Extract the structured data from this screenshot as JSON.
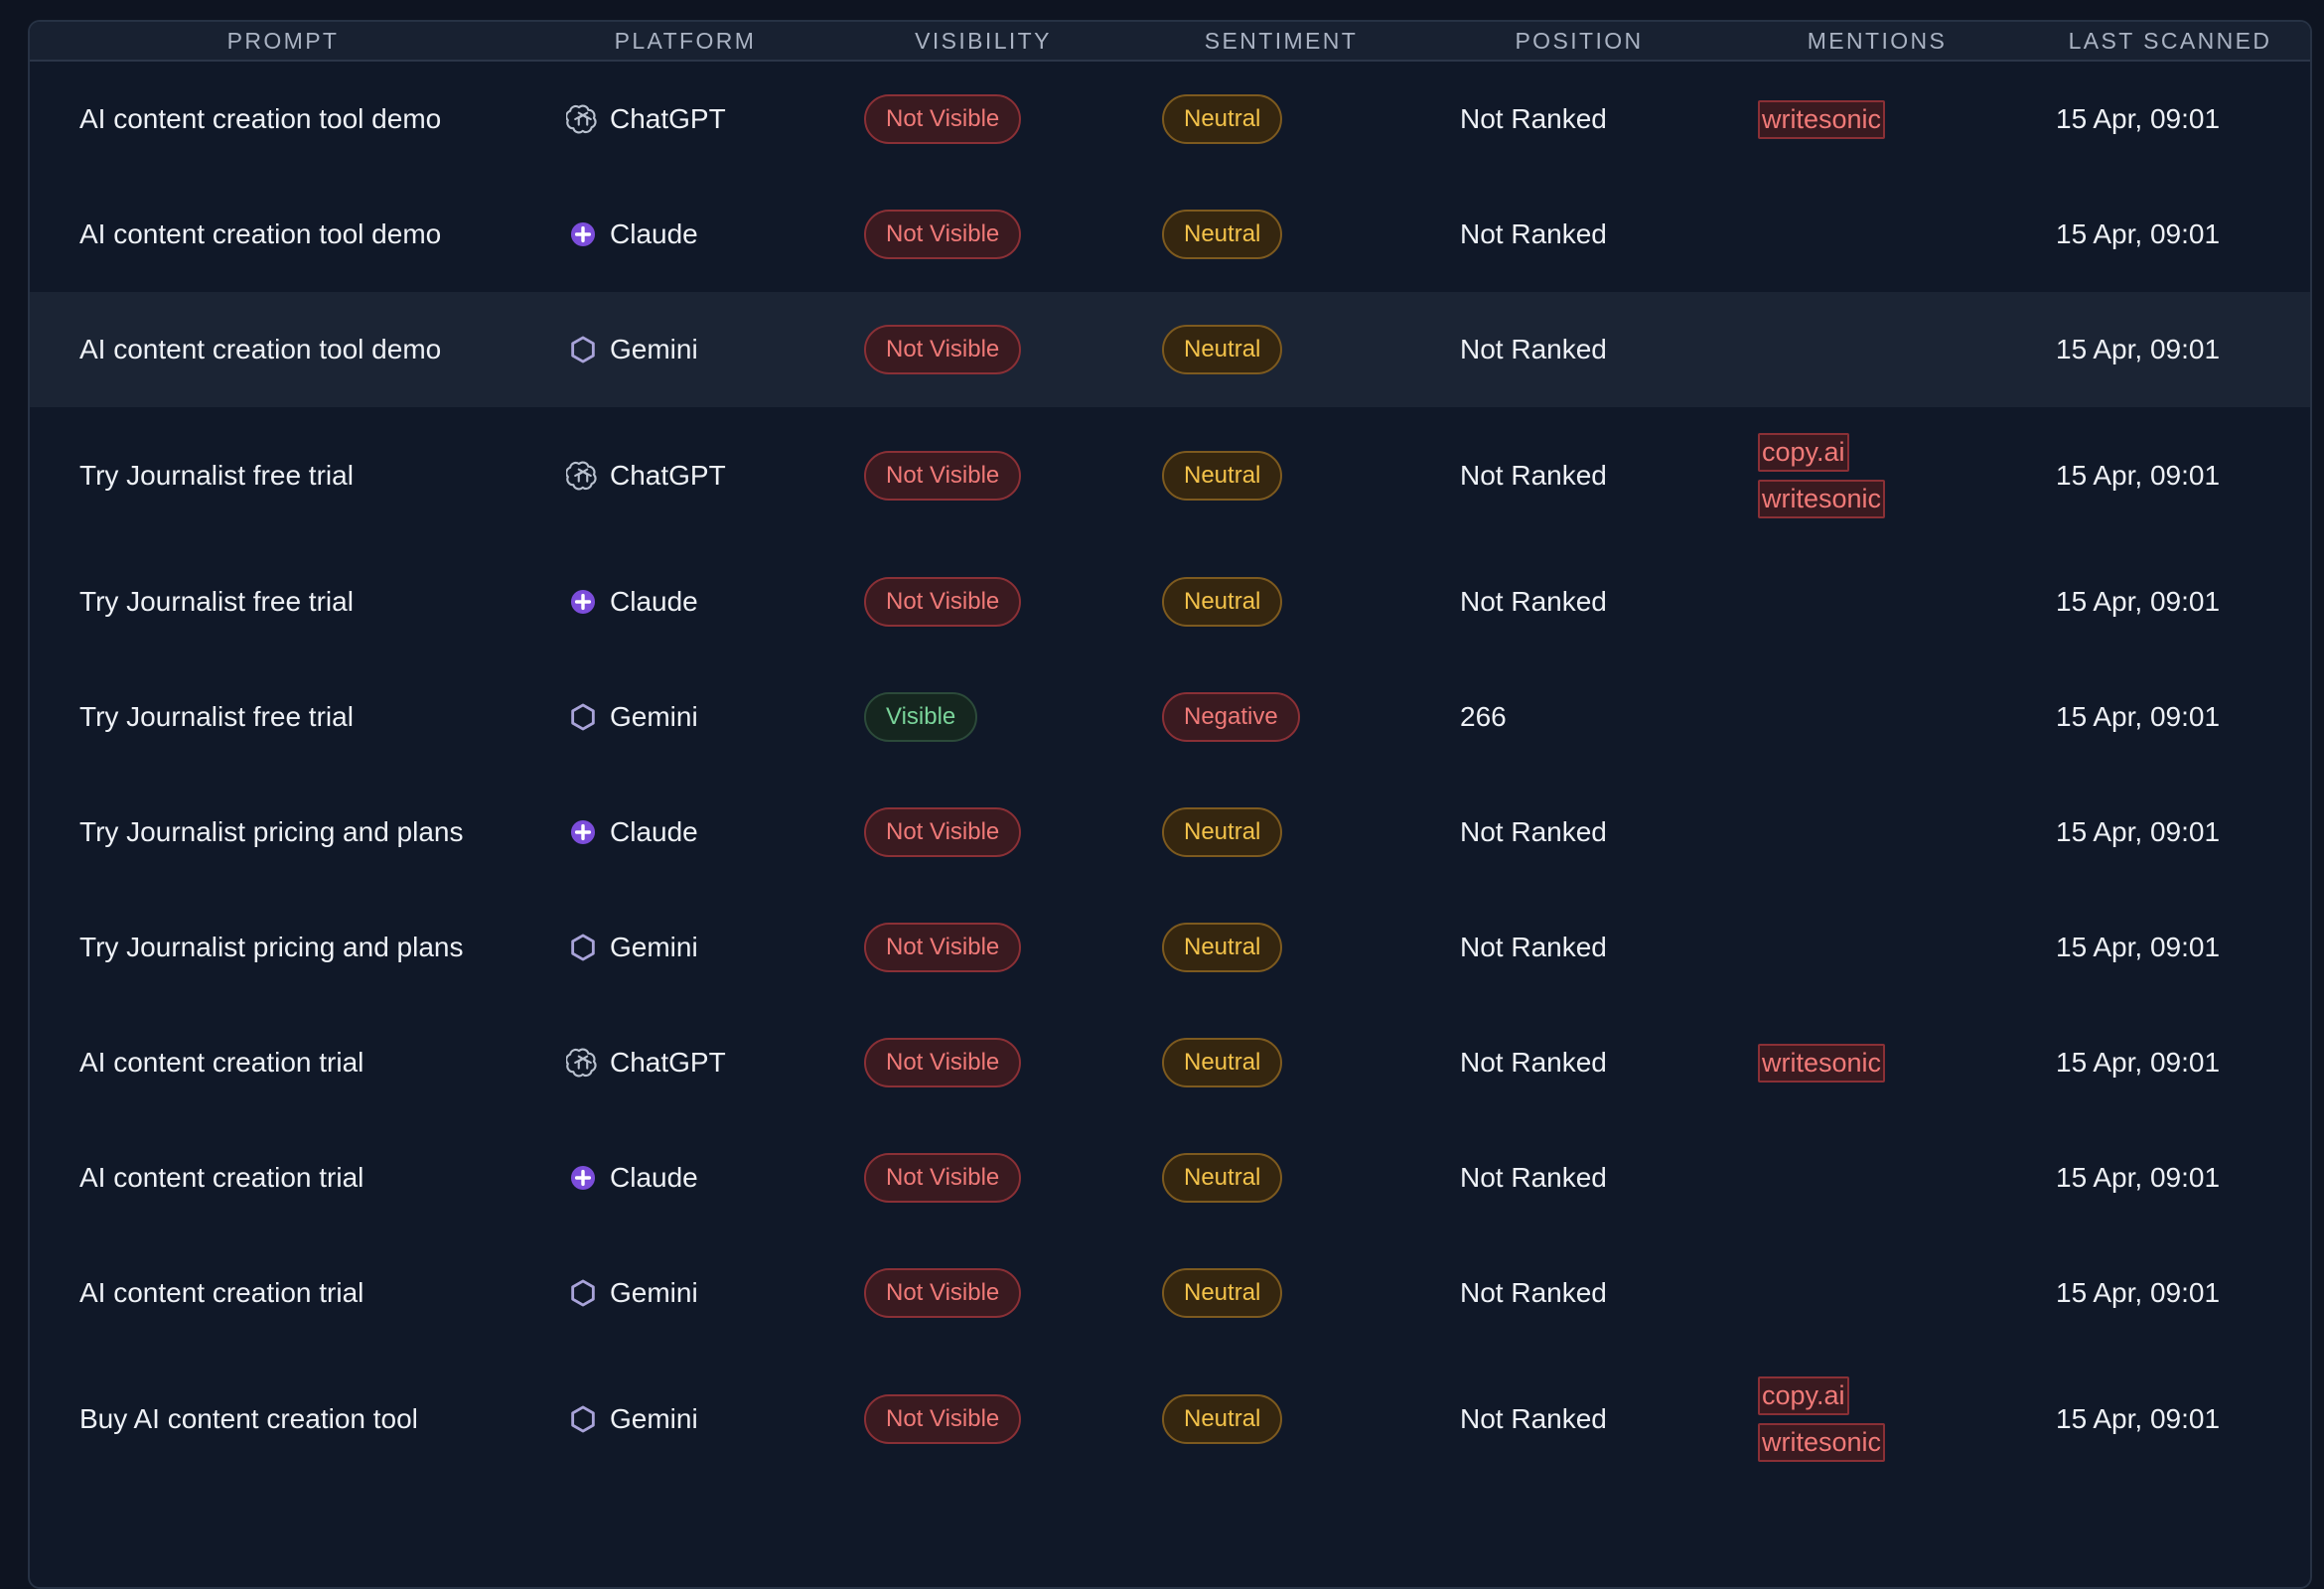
{
  "table": {
    "headers": [
      "Prompt",
      "Platform",
      "Visibility",
      "Sentiment",
      "Position",
      "Mentions",
      "Last Scanned"
    ],
    "rows": [
      {
        "prompt": "AI content creation tool demo",
        "platform": "ChatGPT",
        "platform_icon": "chatgpt-icon",
        "visibility": "Not Visible",
        "sentiment": "Neutral",
        "position": "Not Ranked",
        "mentions": [
          "writesonic"
        ],
        "last_scanned": "15 Apr, 09:01"
      },
      {
        "prompt": "AI content creation tool demo",
        "platform": "Claude",
        "platform_icon": "claude-icon",
        "visibility": "Not Visible",
        "sentiment": "Neutral",
        "position": "Not Ranked",
        "mentions": [],
        "last_scanned": "15 Apr, 09:01"
      },
      {
        "prompt": "AI content creation tool demo",
        "platform": "Gemini",
        "platform_icon": "gemini-icon",
        "visibility": "Not Visible",
        "sentiment": "Neutral",
        "position": "Not Ranked",
        "mentions": [],
        "last_scanned": "15 Apr, 09:01"
      },
      {
        "prompt": "Try Journalist free trial",
        "platform": "ChatGPT",
        "platform_icon": "chatgpt-icon",
        "visibility": "Not Visible",
        "sentiment": "Neutral",
        "position": "Not Ranked",
        "mentions": [
          "copy.ai",
          "writesonic"
        ],
        "last_scanned": "15 Apr, 09:01"
      },
      {
        "prompt": "Try Journalist free trial",
        "platform": "Claude",
        "platform_icon": "claude-icon",
        "visibility": "Not Visible",
        "sentiment": "Neutral",
        "position": "Not Ranked",
        "mentions": [],
        "last_scanned": "15 Apr, 09:01"
      },
      {
        "prompt": "Try Journalist free trial",
        "platform": "Gemini",
        "platform_icon": "gemini-icon",
        "visibility": "Visible",
        "sentiment": "Negative",
        "position": "266",
        "mentions": [],
        "last_scanned": "15 Apr, 09:01"
      },
      {
        "prompt": "Try Journalist pricing and plans",
        "platform": "Claude",
        "platform_icon": "claude-icon",
        "visibility": "Not Visible",
        "sentiment": "Neutral",
        "position": "Not Ranked",
        "mentions": [],
        "last_scanned": "15 Apr, 09:01"
      },
      {
        "prompt": "Try Journalist pricing and plans",
        "platform": "Gemini",
        "platform_icon": "gemini-icon",
        "visibility": "Not Visible",
        "sentiment": "Neutral",
        "position": "Not Ranked",
        "mentions": [],
        "last_scanned": "15 Apr, 09:01"
      },
      {
        "prompt": "AI content creation trial",
        "platform": "ChatGPT",
        "platform_icon": "chatgpt-icon",
        "visibility": "Not Visible",
        "sentiment": "Neutral",
        "position": "Not Ranked",
        "mentions": [
          "writesonic"
        ],
        "last_scanned": "15 Apr, 09:01"
      },
      {
        "prompt": "AI content creation trial",
        "platform": "Claude",
        "platform_icon": "claude-icon",
        "visibility": "Not Visible",
        "sentiment": "Neutral",
        "position": "Not Ranked",
        "mentions": [],
        "last_scanned": "15 Apr, 09:01"
      },
      {
        "prompt": "AI content creation trial",
        "platform": "Gemini",
        "platform_icon": "gemini-icon",
        "visibility": "Not Visible",
        "sentiment": "Neutral",
        "position": "Not Ranked",
        "mentions": [],
        "last_scanned": "15 Apr, 09:01"
      },
      {
        "prompt": "Buy AI content creation tool",
        "platform": "Gemini",
        "platform_icon": "gemini-icon",
        "visibility": "Not Visible",
        "sentiment": "Neutral",
        "position": "Not Ranked",
        "mentions": [
          "copy.ai",
          "writesonic"
        ],
        "last_scanned": "15 Apr, 09:01"
      }
    ]
  },
  "colors": {
    "background": "#0e1421",
    "panel": "#101828",
    "row_hover": "#1b2434",
    "not_visible": "#f07a78",
    "visible": "#7ad49a",
    "neutral": "#f3c24a",
    "negative": "#f07a78",
    "claude_accent": "#8b5cf6"
  }
}
